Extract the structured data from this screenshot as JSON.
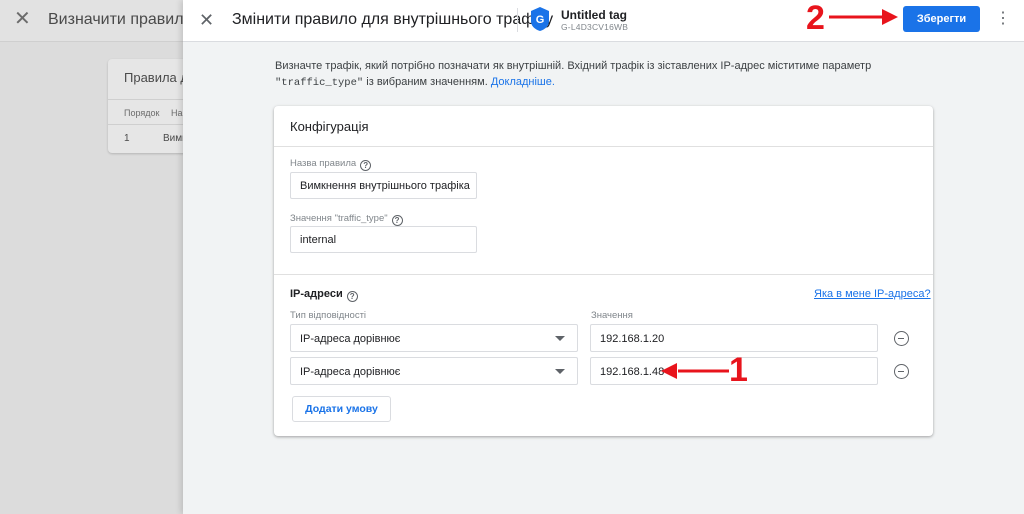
{
  "background": {
    "title": "Визначити правила д",
    "card_title": "Правила дл",
    "columns": [
      "Порядок",
      "На"
    ],
    "row": [
      "1",
      "Вимк"
    ]
  },
  "drawer": {
    "title": "Змінити правило для внутрішнього трафіку",
    "tag_name": "Untitled tag",
    "tag_id": "G-L4D3CV16WB",
    "save_label": "Зберегти",
    "intro_part1": "Визначте трафік, який потрібно позначати як внутрішній. Вхідний трафік із зіставлених IP-адрес міститиме параметр ",
    "intro_code": "\"traffic_type\"",
    "intro_part2": " із вибраним значенням. ",
    "intro_link": "Докладніше."
  },
  "config": {
    "title": "Конфігурація",
    "rule_name_label": "Назва правила",
    "rule_name_value": "Вимкнення внутрішнього трафіка",
    "traffic_type_label": "Значення \"traffic_type\"",
    "traffic_type_value": "internal",
    "ip_section_title": "IP-адреси",
    "ip_link": "Яка в мене IP-адреса?",
    "match_type_label": "Тип відповідності",
    "value_label": "Значення",
    "rows": [
      {
        "match_type": "IP-адреса дорівнює",
        "value": "192.168.1.20"
      },
      {
        "match_type": "IP-адреса дорівнює",
        "value": "192.168.1.48"
      }
    ],
    "add_condition": "Додати умову"
  },
  "annotations": {
    "step1": "1",
    "step2": "2",
    "color": "#e8141c"
  },
  "colors": {
    "accent": "#1a73e8",
    "save_bg": "#1a73e8"
  },
  "icons": [
    "close-icon",
    "google-tag-icon",
    "help-icon",
    "more-vert-icon",
    "remove-circle-icon",
    "dropdown-caret-icon",
    "arrow-icon"
  ]
}
